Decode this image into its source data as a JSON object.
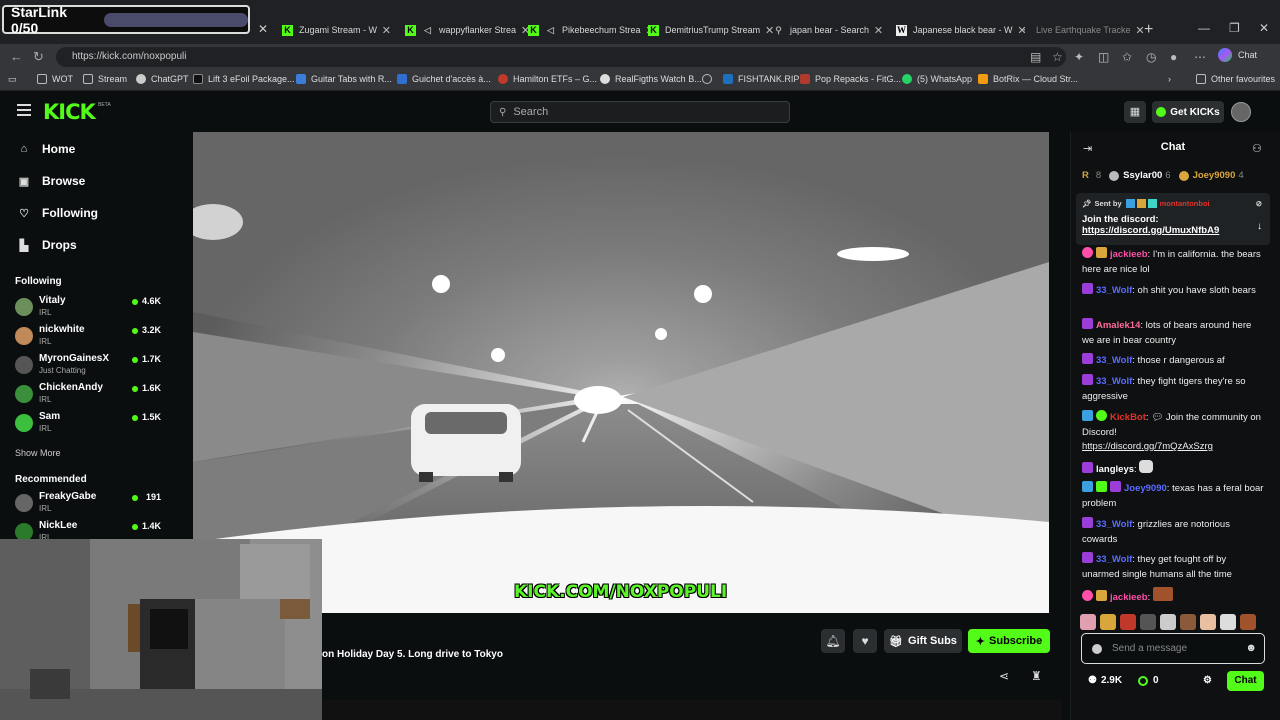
{
  "overlay": {
    "starlink_label": "StarLink 0/50"
  },
  "tabs": [
    {
      "label": "Zugami Stream - W",
      "icon": "kick-icon"
    },
    {
      "label": "wappyflanker Strea",
      "icon": "kick-icon"
    },
    {
      "label": "Pikebeechum Strea",
      "icon": "kick-icon"
    },
    {
      "label": "DemitriusTrump Stream",
      "icon": "kick-icon"
    },
    {
      "label": "japan bear - Search",
      "icon": "search-icon"
    },
    {
      "label": "Japanese black bear - W",
      "icon": "wikipedia-icon"
    },
    {
      "label": "Live Earthquake Tracke",
      "icon": "globe-icon"
    }
  ],
  "address": {
    "url": "https://kick.com/noxpopuli",
    "chat_label": "Chat"
  },
  "bookmarks": [
    {
      "label": "WOT",
      "color": "#888888"
    },
    {
      "label": "Stream",
      "color": "#888888"
    },
    {
      "label": "ChatGPT",
      "color": "#cccccc"
    },
    {
      "label": "Lift 3 eFoil Package...",
      "color": "#1a1a1a"
    },
    {
      "label": "Guitar Tabs with R...",
      "color": "#3b7dd8"
    },
    {
      "label": "Guichet d'accès à...",
      "color": "#2f6fd1"
    },
    {
      "label": "Hamilton ETFs – G...",
      "color": "#c0392b"
    },
    {
      "label": "RealFigths Watch B...",
      "color": "#dddddd"
    },
    {
      "label": "",
      "color": "#bbbbbb"
    },
    {
      "label": "FISHTANK.RIP",
      "color": "#1f6fbf"
    },
    {
      "label": "Pop Repacks - FitG...",
      "color": "#b03a2e"
    },
    {
      "label": "(5) WhatsApp",
      "color": "#25d366"
    },
    {
      "label": "BotRix — Cloud Str...",
      "color": "#f39c12"
    }
  ],
  "bookmarks_other": "Other favourites",
  "header": {
    "logo": "KICK",
    "beta": "BETA",
    "search_placeholder": "Search",
    "get_kicks": "Get KICKs"
  },
  "sidebar": {
    "nav": [
      {
        "label": "Home",
        "icon": "home-icon"
      },
      {
        "label": "Browse",
        "icon": "browse-icon"
      },
      {
        "label": "Following",
        "icon": "heart-icon"
      },
      {
        "label": "Drops",
        "icon": "drops-icon"
      }
    ],
    "following_title": "Following",
    "following": [
      {
        "name": "Vitaly",
        "category": "IRL",
        "viewers": "4.6K",
        "color": "#6a8f5a"
      },
      {
        "name": "nickwhite",
        "category": "IRL",
        "viewers": "3.2K",
        "color": "#c08a5a"
      },
      {
        "name": "MyronGainesX",
        "category": "Just Chatting",
        "viewers": "1.7K",
        "color": "#555555"
      },
      {
        "name": "ChickenAndy",
        "category": "IRL",
        "viewers": "1.6K",
        "color": "#3a8f3a"
      },
      {
        "name": "Sam",
        "category": "IRL",
        "viewers": "1.5K",
        "color": "#3cbf3c"
      }
    ],
    "show_more": "Show More",
    "recommended_title": "Recommended",
    "recommended": [
      {
        "name": "FreakyGabe",
        "category": "IRL",
        "viewers": "191",
        "color": "#666666"
      },
      {
        "name": "NickLee",
        "category": "IRL",
        "viewers": "1.4K",
        "color": "#2b7a2b"
      }
    ]
  },
  "video": {
    "watermark": "KICK.COM/NOXPOPULI"
  },
  "stream": {
    "title": "on Holiday Day 5. Long drive to Tokyo",
    "gift_subs": "Gift Subs",
    "subscribe": "Subscribe"
  },
  "chat": {
    "title": "Chat",
    "gifters": [
      {
        "rank": "R",
        "count": "8"
      },
      {
        "name": "Ssylar00",
        "count": "6"
      },
      {
        "name": "Joey9090",
        "count": "4"
      }
    ],
    "pinned": {
      "sent_by": "Sent by",
      "sender": "montantonboi",
      "text": "Join the discord:",
      "link": "https://discord.gg/UmuxNfbA9"
    },
    "messages": [
      {
        "user": "jackieeb",
        "color": "#ff4fa8",
        "text": "I'm in california. the bears here are nice lol"
      },
      {
        "user": "33_Wolf",
        "color": "#5b6cff",
        "text": "oh shit you have sloth bears"
      },
      {
        "user": "Amalek14",
        "color": "#ff6b9a",
        "text": "lots of bears around here we are in bear country"
      },
      {
        "user": "33_Wolf",
        "color": "#5b6cff",
        "text": "those r dangerous af"
      },
      {
        "user": "33_Wolf",
        "color": "#5b6cff",
        "text": "they fight tigers they're so aggressive"
      },
      {
        "user": "KickBot",
        "color": "#e0332c",
        "text": "Join the community on Discord!",
        "link": "https://discord.gg/7mQzAxSzrg"
      },
      {
        "user": "langleys",
        "color": "#ffffff",
        "text": ""
      },
      {
        "user": "Joey9090",
        "color": "#5b6cff",
        "text": "texas has a feral boar problem"
      },
      {
        "user": "33_Wolf",
        "color": "#5b6cff",
        "text": "grizzlies are notorious cowards"
      },
      {
        "user": "33_Wolf",
        "color": "#5b6cff",
        "text": "they get fought off by unarmed single humans all the time"
      },
      {
        "user": "jackieeb",
        "color": "#ff4fa8",
        "text": ""
      }
    ],
    "input_placeholder": "Send a message",
    "followers": "2.9K",
    "kicks": "0",
    "send_label": "Chat"
  }
}
